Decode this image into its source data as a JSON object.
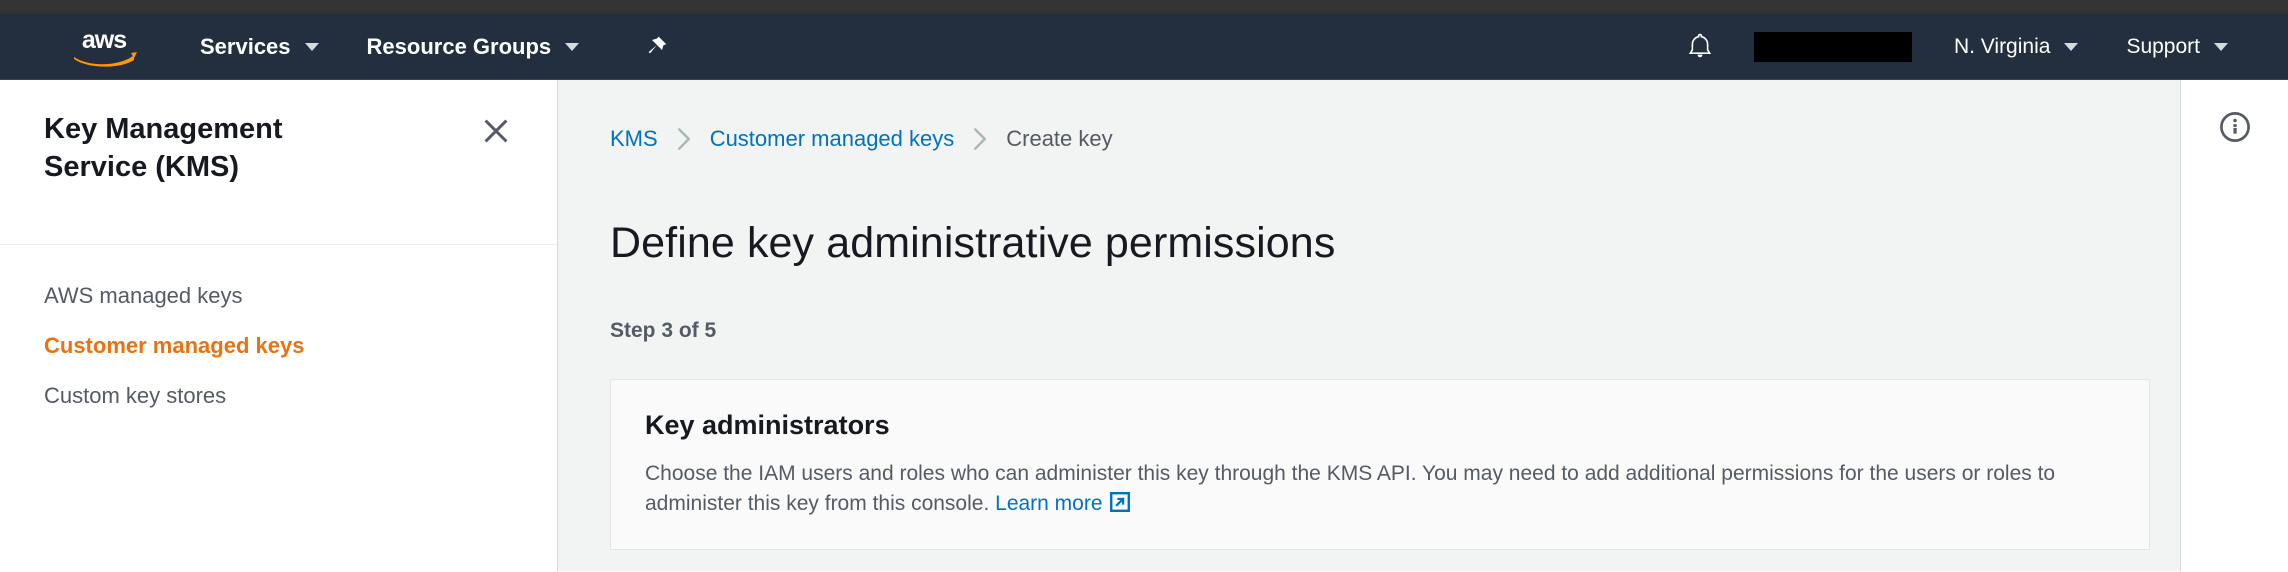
{
  "navbar": {
    "logo_alt": "aws",
    "items": [
      {
        "label": "Services",
        "has_caret": true
      },
      {
        "label": "Resource Groups",
        "has_caret": true
      }
    ],
    "pin_icon": "pushpin-icon",
    "bell_icon": "notifications-bell-icon",
    "account_redacted": "",
    "region": {
      "label": "N. Virginia",
      "has_caret": true
    },
    "support": {
      "label": "Support",
      "has_caret": true
    }
  },
  "sidebar": {
    "title": "Key Management Service (KMS)",
    "close_icon": "close-icon",
    "items": [
      {
        "label": "AWS managed keys",
        "active": false
      },
      {
        "label": "Customer managed keys",
        "active": true
      },
      {
        "label": "Custom key stores",
        "active": false
      }
    ]
  },
  "breadcrumb": [
    {
      "label": "KMS",
      "current": false
    },
    {
      "label": "Customer managed keys",
      "current": false
    },
    {
      "label": "Create key",
      "current": true
    }
  ],
  "main": {
    "page_title": "Define key administrative permissions",
    "step_label": "Step 3 of 5",
    "card": {
      "title": "Key administrators",
      "description": "Choose the IAM users and roles who can administer this key through the KMS API. You may need to add additional permissions for the users or roles to administer this key from this console.",
      "learn_more_label": "Learn more",
      "learn_more_icon": "external-link-icon"
    }
  },
  "info_rail": {
    "info_icon": "info-circle-icon"
  },
  "colors": {
    "nav_background": "#232f3e",
    "top_strip": "#333333",
    "accent_orange": "#ec7211",
    "link_blue": "#0073bb",
    "content_background": "#f2f3f3",
    "text_dark": "#16191f",
    "text_muted": "#545b64"
  }
}
